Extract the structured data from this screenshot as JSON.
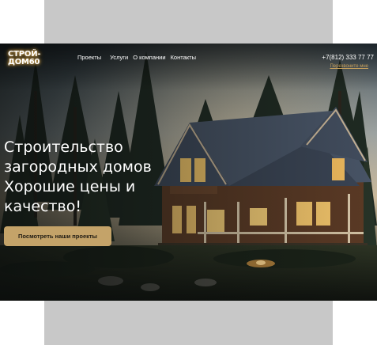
{
  "logo": {
    "line1": "СТРОЙ-",
    "line2": "ДОМ60"
  },
  "nav": {
    "items": [
      "Проекты",
      "Услуги",
      "О компании",
      "Контакты"
    ]
  },
  "contact": {
    "phone": "+7(812) 333 77 77",
    "callback_label": "Перезвоните мне"
  },
  "hero": {
    "headline_lines": [
      "Строительство",
      "загородных домов",
      "Хорошие цены и",
      "качество!"
    ],
    "cta_label": "Посмотреть наши проекты"
  },
  "colors": {
    "accent": "#c4a369",
    "callback_link": "#c9a15c",
    "logo_glow": "#e0b25a",
    "page_frame": "#c8c8c8"
  },
  "icons": {
    "background": "house-photo"
  }
}
